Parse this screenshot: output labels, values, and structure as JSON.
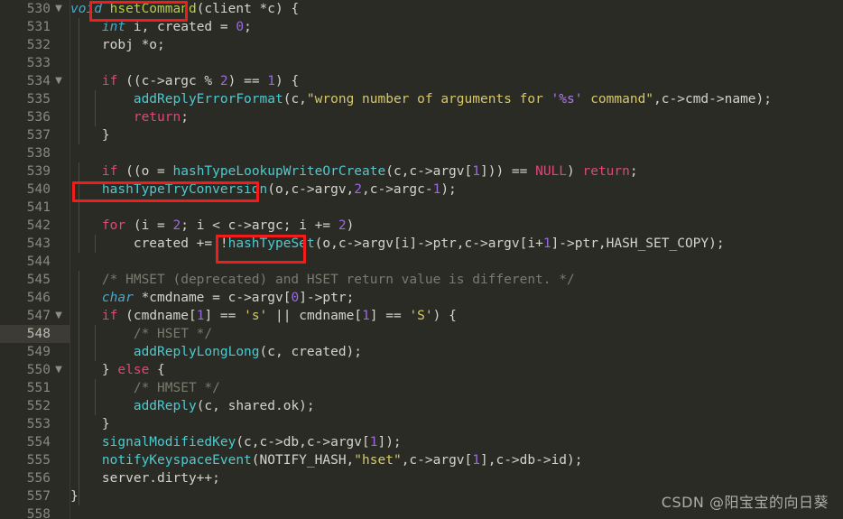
{
  "editor": {
    "background": "#2b2b26",
    "gutter_background": "#2b2b26",
    "active_line_number": 548,
    "active_line_gutter_color": "#3c3c34",
    "first_visible_line": 530,
    "last_visible_line": 558,
    "annotation_color": "#f41b1b"
  },
  "gutter": {
    "numbers": [
      {
        "n": "530",
        "fold": "▼"
      },
      {
        "n": "531",
        "fold": ""
      },
      {
        "n": "532",
        "fold": ""
      },
      {
        "n": "533",
        "fold": ""
      },
      {
        "n": "534",
        "fold": "▼"
      },
      {
        "n": "535",
        "fold": ""
      },
      {
        "n": "536",
        "fold": ""
      },
      {
        "n": "537",
        "fold": ""
      },
      {
        "n": "538",
        "fold": ""
      },
      {
        "n": "539",
        "fold": ""
      },
      {
        "n": "540",
        "fold": ""
      },
      {
        "n": "541",
        "fold": ""
      },
      {
        "n": "542",
        "fold": ""
      },
      {
        "n": "543",
        "fold": ""
      },
      {
        "n": "544",
        "fold": ""
      },
      {
        "n": "545",
        "fold": ""
      },
      {
        "n": "546",
        "fold": ""
      },
      {
        "n": "547",
        "fold": "▼"
      },
      {
        "n": "548",
        "fold": ""
      },
      {
        "n": "549",
        "fold": ""
      },
      {
        "n": "550",
        "fold": "▼"
      },
      {
        "n": "551",
        "fold": ""
      },
      {
        "n": "552",
        "fold": ""
      },
      {
        "n": "553",
        "fold": ""
      },
      {
        "n": "554",
        "fold": ""
      },
      {
        "n": "555",
        "fold": ""
      },
      {
        "n": "556",
        "fold": ""
      },
      {
        "n": "557",
        "fold": ""
      },
      {
        "n": "558",
        "fold": ""
      }
    ]
  },
  "code": {
    "language": "c",
    "lines": [
      "void hsetCommand(client *c) {",
      "    int i, created = 0;",
      "    robj *o;",
      "",
      "    if ((c->argc % 2) == 1) {",
      "        addReplyErrorFormat(c,\"wrong number of arguments for '%s' command\",c->cmd->name);",
      "        return;",
      "    }",
      "",
      "    if ((o = hashTypeLookupWriteOrCreate(c,c->argv[1])) == NULL) return;",
      "    hashTypeTryConversion(o,c->argv,2,c->argc-1);",
      "",
      "    for (i = 2; i < c->argc; i += 2)",
      "        created += !hashTypeSet(o,c->argv[i]->ptr,c->argv[i+1]->ptr,HASH_SET_COPY);",
      "",
      "    /* HMSET (deprecated) and HSET return value is different. */",
      "    char *cmdname = c->argv[0]->ptr;",
      "    if (cmdname[1] == 's' || cmdname[1] == 'S') {",
      "        /* HSET */",
      "        addReplyLongLong(c, created);",
      "    } else {",
      "        /* HMSET */",
      "        addReply(c, shared.ok);",
      "    }",
      "    signalModifiedKey(c,c->db,c->argv[1]);",
      "    notifyKeyspaceEvent(NOTIFY_HASH,\"hset\",c->argv[1],c->db->id);",
      "    server.dirty++;",
      "}",
      ""
    ]
  },
  "annotations": [
    {
      "label": "hsetCommand",
      "line": 530
    },
    {
      "label": "hashTypeTryConversion",
      "line": 540
    },
    {
      "label": "hashTypeSet",
      "line": 543
    }
  ],
  "watermark": {
    "text": "CSDN @阳宝宝的向日葵"
  }
}
